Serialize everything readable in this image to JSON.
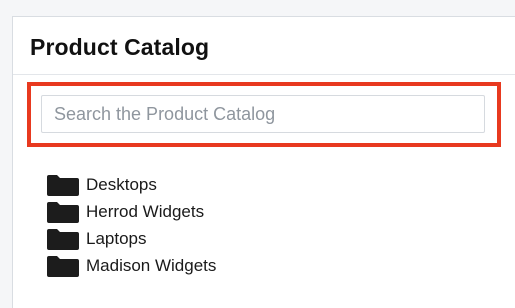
{
  "panel": {
    "title": "Product Catalog"
  },
  "search": {
    "placeholder": "Search the Product Catalog",
    "value": "",
    "highlight_color": "#e8391f"
  },
  "folders": [
    {
      "label": "Desktops",
      "icon": "folder-icon"
    },
    {
      "label": "Herrod Widgets",
      "icon": "folder-icon"
    },
    {
      "label": "Laptops",
      "icon": "folder-icon"
    },
    {
      "label": "Madison Widgets",
      "icon": "folder-icon"
    }
  ]
}
